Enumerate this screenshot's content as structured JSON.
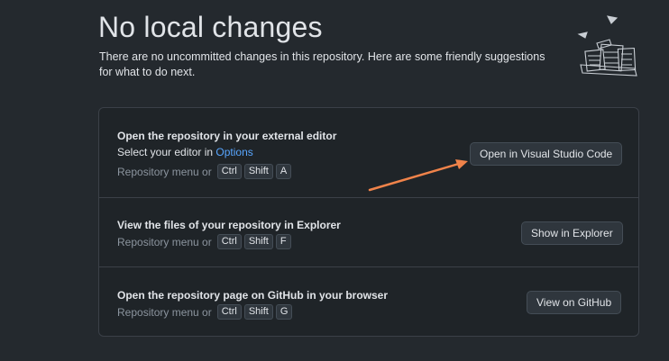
{
  "header": {
    "title": "No local changes",
    "subtitle": "There are no uncommitted changes in this repository. Here are some friendly suggestions for what to do next."
  },
  "suggestions": [
    {
      "title": "Open the repository in your external editor",
      "desc_prefix": "Select your editor in ",
      "desc_link": "Options",
      "hint_lead": "Repository menu or",
      "keys": [
        "Ctrl",
        "Shift",
        "A"
      ],
      "button": "Open in Visual Studio Code"
    },
    {
      "title": "View the files of your repository in Explorer",
      "hint_lead": "Repository menu or",
      "keys": [
        "Ctrl",
        "Shift",
        "F"
      ],
      "button": "Show in Explorer"
    },
    {
      "title": "Open the repository page on GitHub in your browser",
      "hint_lead": "Repository menu or",
      "keys": [
        "Ctrl",
        "Shift",
        "G"
      ],
      "button": "View on GitHub"
    }
  ],
  "colors": {
    "background": "#24292e",
    "panel": "#1f2428",
    "link": "#58a6ff",
    "annotation_arrow": "#f0834a"
  },
  "icons": {
    "illustration": "paper-stack-illustration-icon",
    "annotation": "orange-arrow-annotation"
  }
}
